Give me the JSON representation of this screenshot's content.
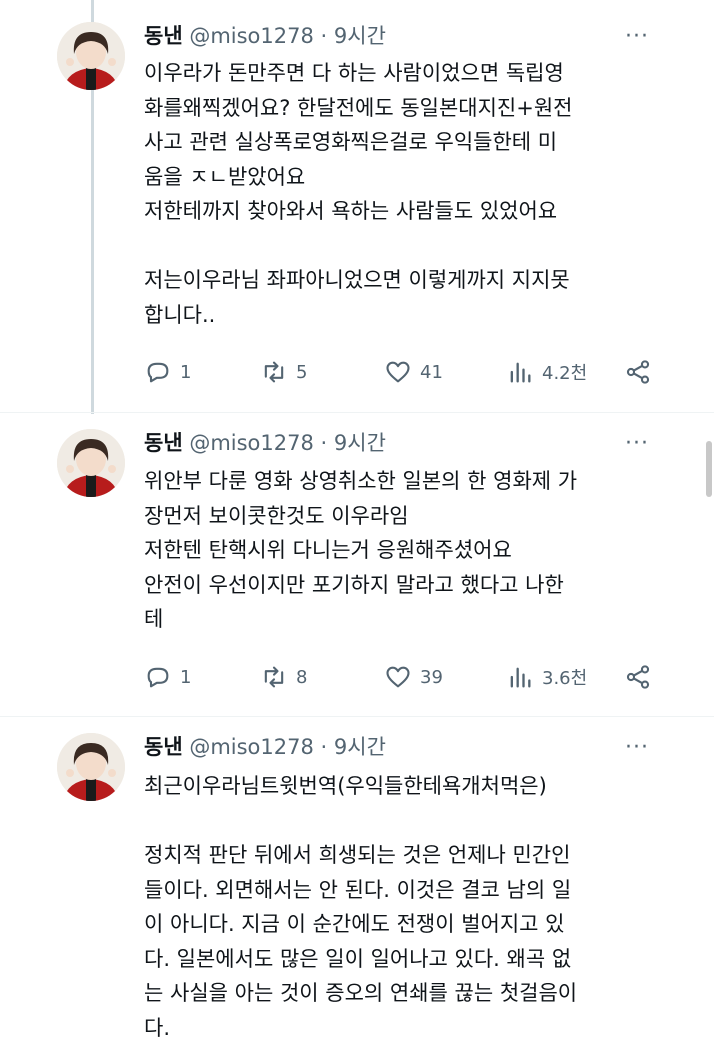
{
  "tweets": [
    {
      "name": "동낸",
      "handle": "@miso1278",
      "dot": "·",
      "time": "9시간",
      "more": "···",
      "text": "이우라가 돈만주면 다 하는 사람이었으면 독립영\n화를왜찍겠어요? 한달전에도 동일본대지진+원전\n사고 관련 실상폭로영화찍은걸로 우익들한테 미\n움을 ㅈㄴ받았어요\n저한테까지 찾아와서 욕하는 사람들도 있었어요\n\n저는이우라님 좌파아니었으면 이렇게까지 지지못\n합니다..",
      "replies": "1",
      "retweets": "5",
      "likes": "41",
      "views": "4.2천"
    },
    {
      "name": "동낸",
      "handle": "@miso1278",
      "dot": "·",
      "time": "9시간",
      "more": "···",
      "text": "위안부 다룬 영화 상영취소한 일본의 한 영화제 가\n장먼저 보이콧한것도 이우라임\n저한텐 탄핵시위 다니는거 응원해주셨어요\n안전이 우선이지만 포기하지 말라고 했다고 나한\n테",
      "replies": "1",
      "retweets": "8",
      "likes": "39",
      "views": "3.6천"
    },
    {
      "name": "동낸",
      "handle": "@miso1278",
      "dot": "·",
      "time": "9시간",
      "more": "···",
      "text": "최근이우라님트윗번역(우익들한테욕개처먹은)\n\n정치적 판단 뒤에서 희생되는 것은 언제나 민간인\n들이다. 외면해서는 안 된다. 이것은 결코 남의 일\n이 아니다. 지금 이 순간에도 전쟁이 벌어지고 있\n다. 일본에서도 많은 일이 일어나고 있다. 왜곡 없\n는 사실을 아는 것이 증오의 연쇄를 끊는 첫걸음이\n다."
    }
  ],
  "colors": {
    "text": "#0f1419",
    "muted": "#536471",
    "thread_line": "#cfd9de"
  }
}
